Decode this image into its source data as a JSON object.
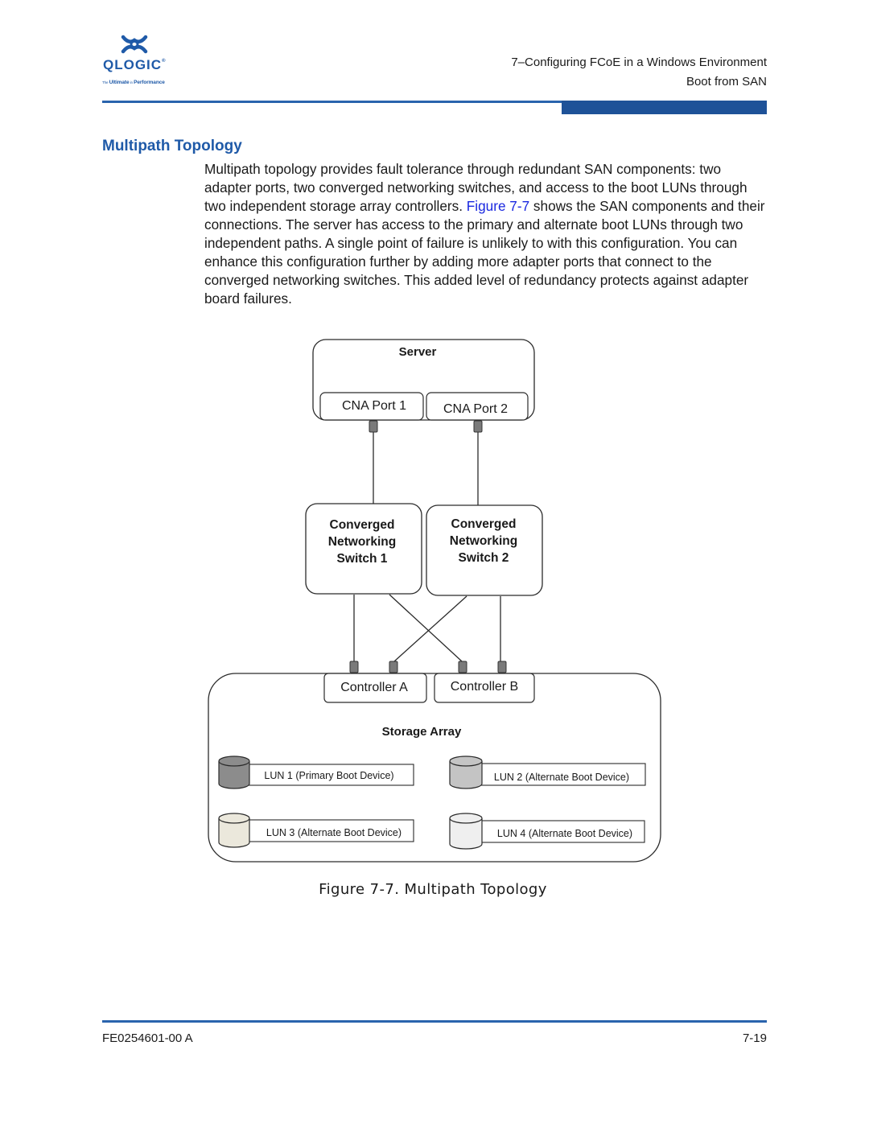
{
  "header": {
    "logo": {
      "brand": "QLOGIC",
      "registered_mark": "®",
      "tagline_prefix": "The ",
      "tagline_bold1": "Ultimate",
      "tagline_mid": " in ",
      "tagline_bold2": "Performance",
      "icon": "qlogic-knot-icon"
    },
    "chapter": "7–Configuring FCoE in a Windows Environment",
    "section": "Boot from SAN",
    "accent_color": "#1e5298"
  },
  "section": {
    "title": "Multipath Topology",
    "paragraph_before_link": "Multipath topology provides fault tolerance through redundant SAN components: two adapter ports, two converged networking switches, and access to the boot LUNs through two independent storage array controllers. ",
    "link_text": "Figure 7-7",
    "paragraph_after_link": " shows the SAN components and their connections. The server has access to the primary and alternate boot LUNs through two independent paths. A single point of failure is unlikely to with this configuration. You can enhance this configuration further by adding more adapter ports that connect to the converged networking switches. This added level of redundancy protects against adapter board failures.",
    "link_color": "#1a28e0"
  },
  "diagram": {
    "server": {
      "label": "Server",
      "ports": [
        "CNA Port 1",
        "CNA Port 2"
      ]
    },
    "switches": [
      {
        "lines": [
          "Converged",
          "Networking",
          "Switch 1"
        ]
      },
      {
        "lines": [
          "Converged",
          "Networking",
          "Switch 2"
        ]
      }
    ],
    "storage_array": {
      "label": "Storage Array",
      "controllers": [
        "Controller A",
        "Controller B"
      ],
      "luns": [
        {
          "label": "LUN 1 (Primary Boot Device)",
          "color": "#8c8c8c"
        },
        {
          "label": "LUN 2 (Alternate Boot Device)",
          "color": "#c4c4c4"
        },
        {
          "label": "LUN 3 (Alternate Boot Device)",
          "color": "#ebe8dc"
        },
        {
          "label": "LUN 4 (Alternate Boot Device)",
          "color": "#efefef"
        }
      ]
    },
    "connections": [
      {
        "from": "CNA Port 1",
        "to": "Converged Networking Switch 1"
      },
      {
        "from": "CNA Port 2",
        "to": "Converged Networking Switch 2"
      },
      {
        "from": "Converged Networking Switch 1",
        "to": "Controller A"
      },
      {
        "from": "Converged Networking Switch 1",
        "to": "Controller B"
      },
      {
        "from": "Converged Networking Switch 2",
        "to": "Controller A"
      },
      {
        "from": "Converged Networking Switch 2",
        "to": "Controller B"
      }
    ],
    "caption": "Figure 7-7. Multipath Topology"
  },
  "footer": {
    "doc_id": "FE0254601-00 A",
    "page_number": "7-19"
  }
}
